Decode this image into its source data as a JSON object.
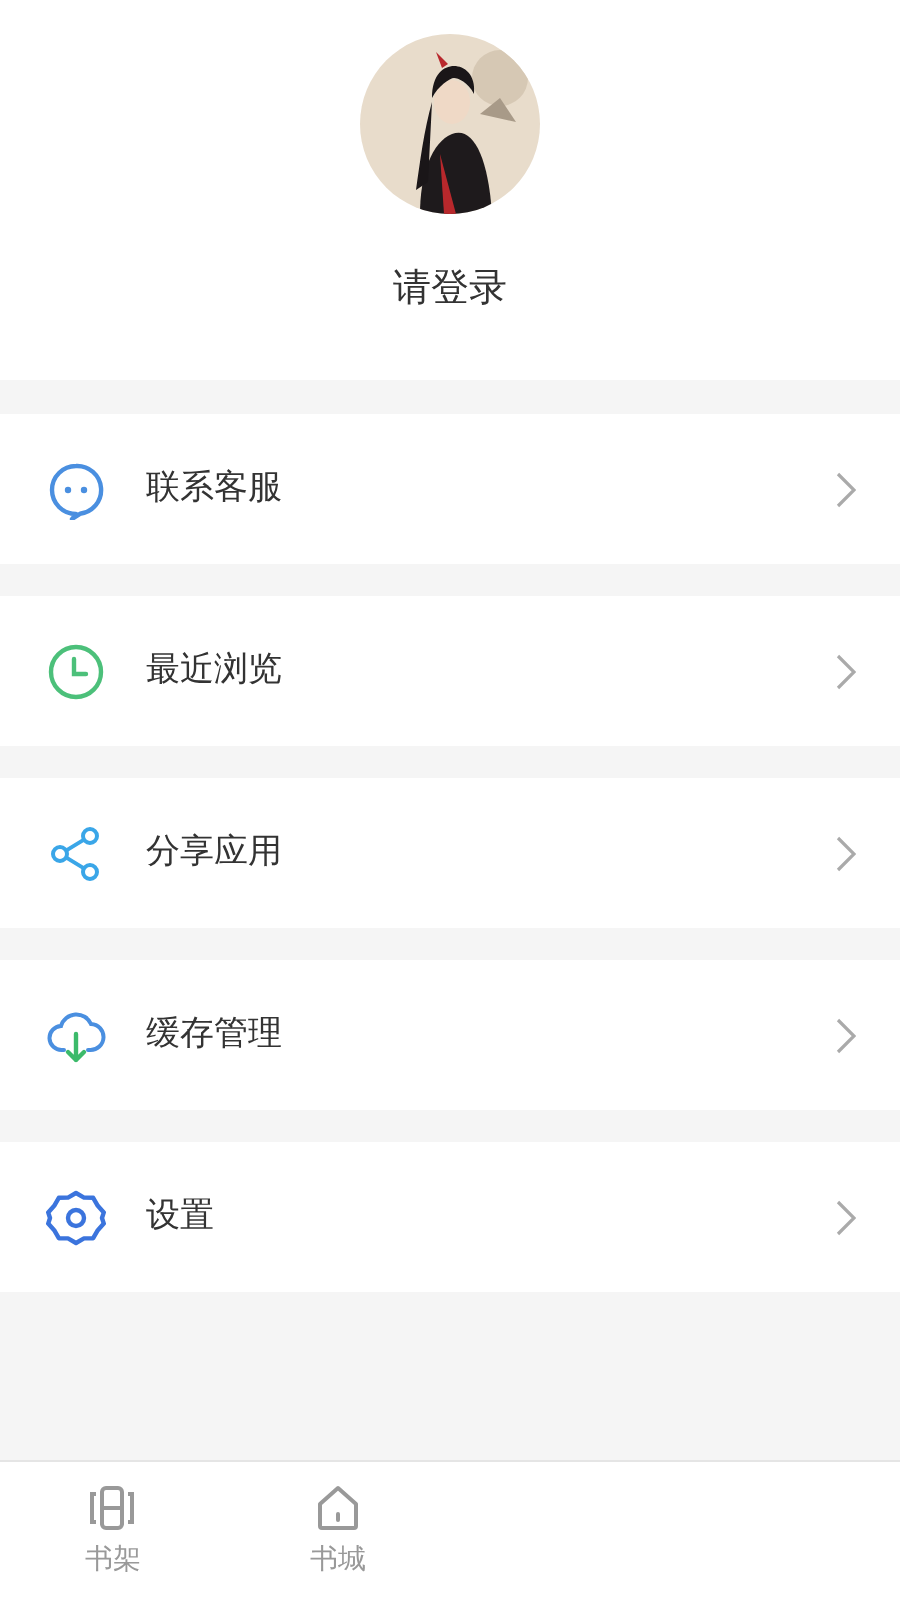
{
  "profile": {
    "login_label": "请登录"
  },
  "menu": [
    {
      "kind": "chat",
      "label": "联系客服"
    },
    {
      "kind": "clock",
      "label": "最近浏览"
    },
    {
      "kind": "share",
      "label": "分享应用"
    },
    {
      "kind": "cloud",
      "label": "缓存管理"
    },
    {
      "kind": "gear",
      "label": "设置"
    }
  ],
  "tab_bar": [
    {
      "kind": "shelf",
      "label": "书架"
    },
    {
      "kind": "home",
      "label": "书城"
    }
  ]
}
